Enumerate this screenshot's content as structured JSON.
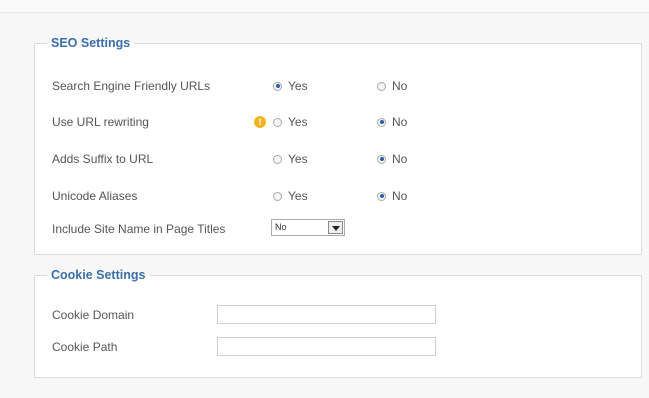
{
  "seo_settings": {
    "legend": "SEO Settings",
    "rows": [
      {
        "label": "Search Engine Friendly URLs",
        "yes": "Yes",
        "no": "No",
        "selected": "yes"
      },
      {
        "label": "Use URL rewriting",
        "yes": "Yes",
        "no": "No",
        "selected": "no",
        "warning_icon": "warning-icon"
      },
      {
        "label": "Adds Suffix to URL",
        "yes": "Yes",
        "no": "No",
        "selected": "no"
      },
      {
        "label": "Unicode Aliases",
        "yes": "Yes",
        "no": "No",
        "selected": "no"
      }
    ],
    "site_name_in_titles": {
      "label": "Include Site Name in Page Titles",
      "value": "No"
    }
  },
  "cookie_settings": {
    "legend": "Cookie Settings",
    "cookie_domain": {
      "label": "Cookie Domain",
      "value": ""
    },
    "cookie_path": {
      "label": "Cookie Path",
      "value": ""
    }
  },
  "colors": {
    "legend": "#3a6fa8",
    "radio_selected": "#2e5fa3",
    "warning": "#f0b420"
  }
}
